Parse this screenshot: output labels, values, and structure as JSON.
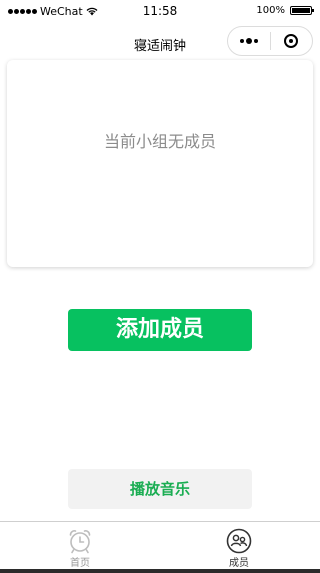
{
  "status_bar": {
    "carrier": "WeChat",
    "time": "11:58",
    "battery": "100%",
    "battery_level": 1.0
  },
  "nav": {
    "title": "寝适闹钟"
  },
  "members_card": {
    "empty_message": "当前小组无成员"
  },
  "actions": {
    "add_member": "添加成员",
    "play_music": "播放音乐"
  },
  "tabbar": {
    "items": [
      {
        "label": "首页",
        "icon": "alarm-clock-icon",
        "selected": false
      },
      {
        "label": "成员",
        "icon": "members-icon",
        "selected": true
      }
    ]
  },
  "colors": {
    "primary_green": "#07c160",
    "play_text_green": "#1aad52",
    "muted_text": "#8c8c8c"
  }
}
